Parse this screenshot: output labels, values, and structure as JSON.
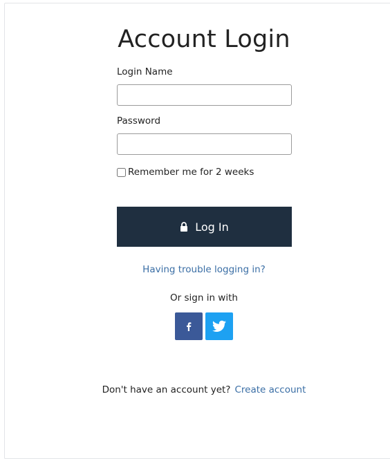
{
  "title": "Account Login",
  "login_name": {
    "label": "Login Name",
    "value": "",
    "placeholder": ""
  },
  "password": {
    "label": "Password",
    "value": "",
    "placeholder": ""
  },
  "remember": {
    "label": "Remember me for 2 weeks",
    "checked": false
  },
  "login_button": {
    "label": "Log In",
    "icon": "lock-icon"
  },
  "trouble_link": "Having trouble logging in?",
  "social": {
    "label": "Or sign in with",
    "providers": [
      "facebook-icon",
      "twitter-icon"
    ]
  },
  "signup": {
    "prompt": "Don't have an account yet?",
    "link": "Create account"
  },
  "colors": {
    "button_bg": "#1f2f40",
    "link": "#3a6ea5",
    "facebook": "#3b5998",
    "twitter": "#1da1f2"
  }
}
